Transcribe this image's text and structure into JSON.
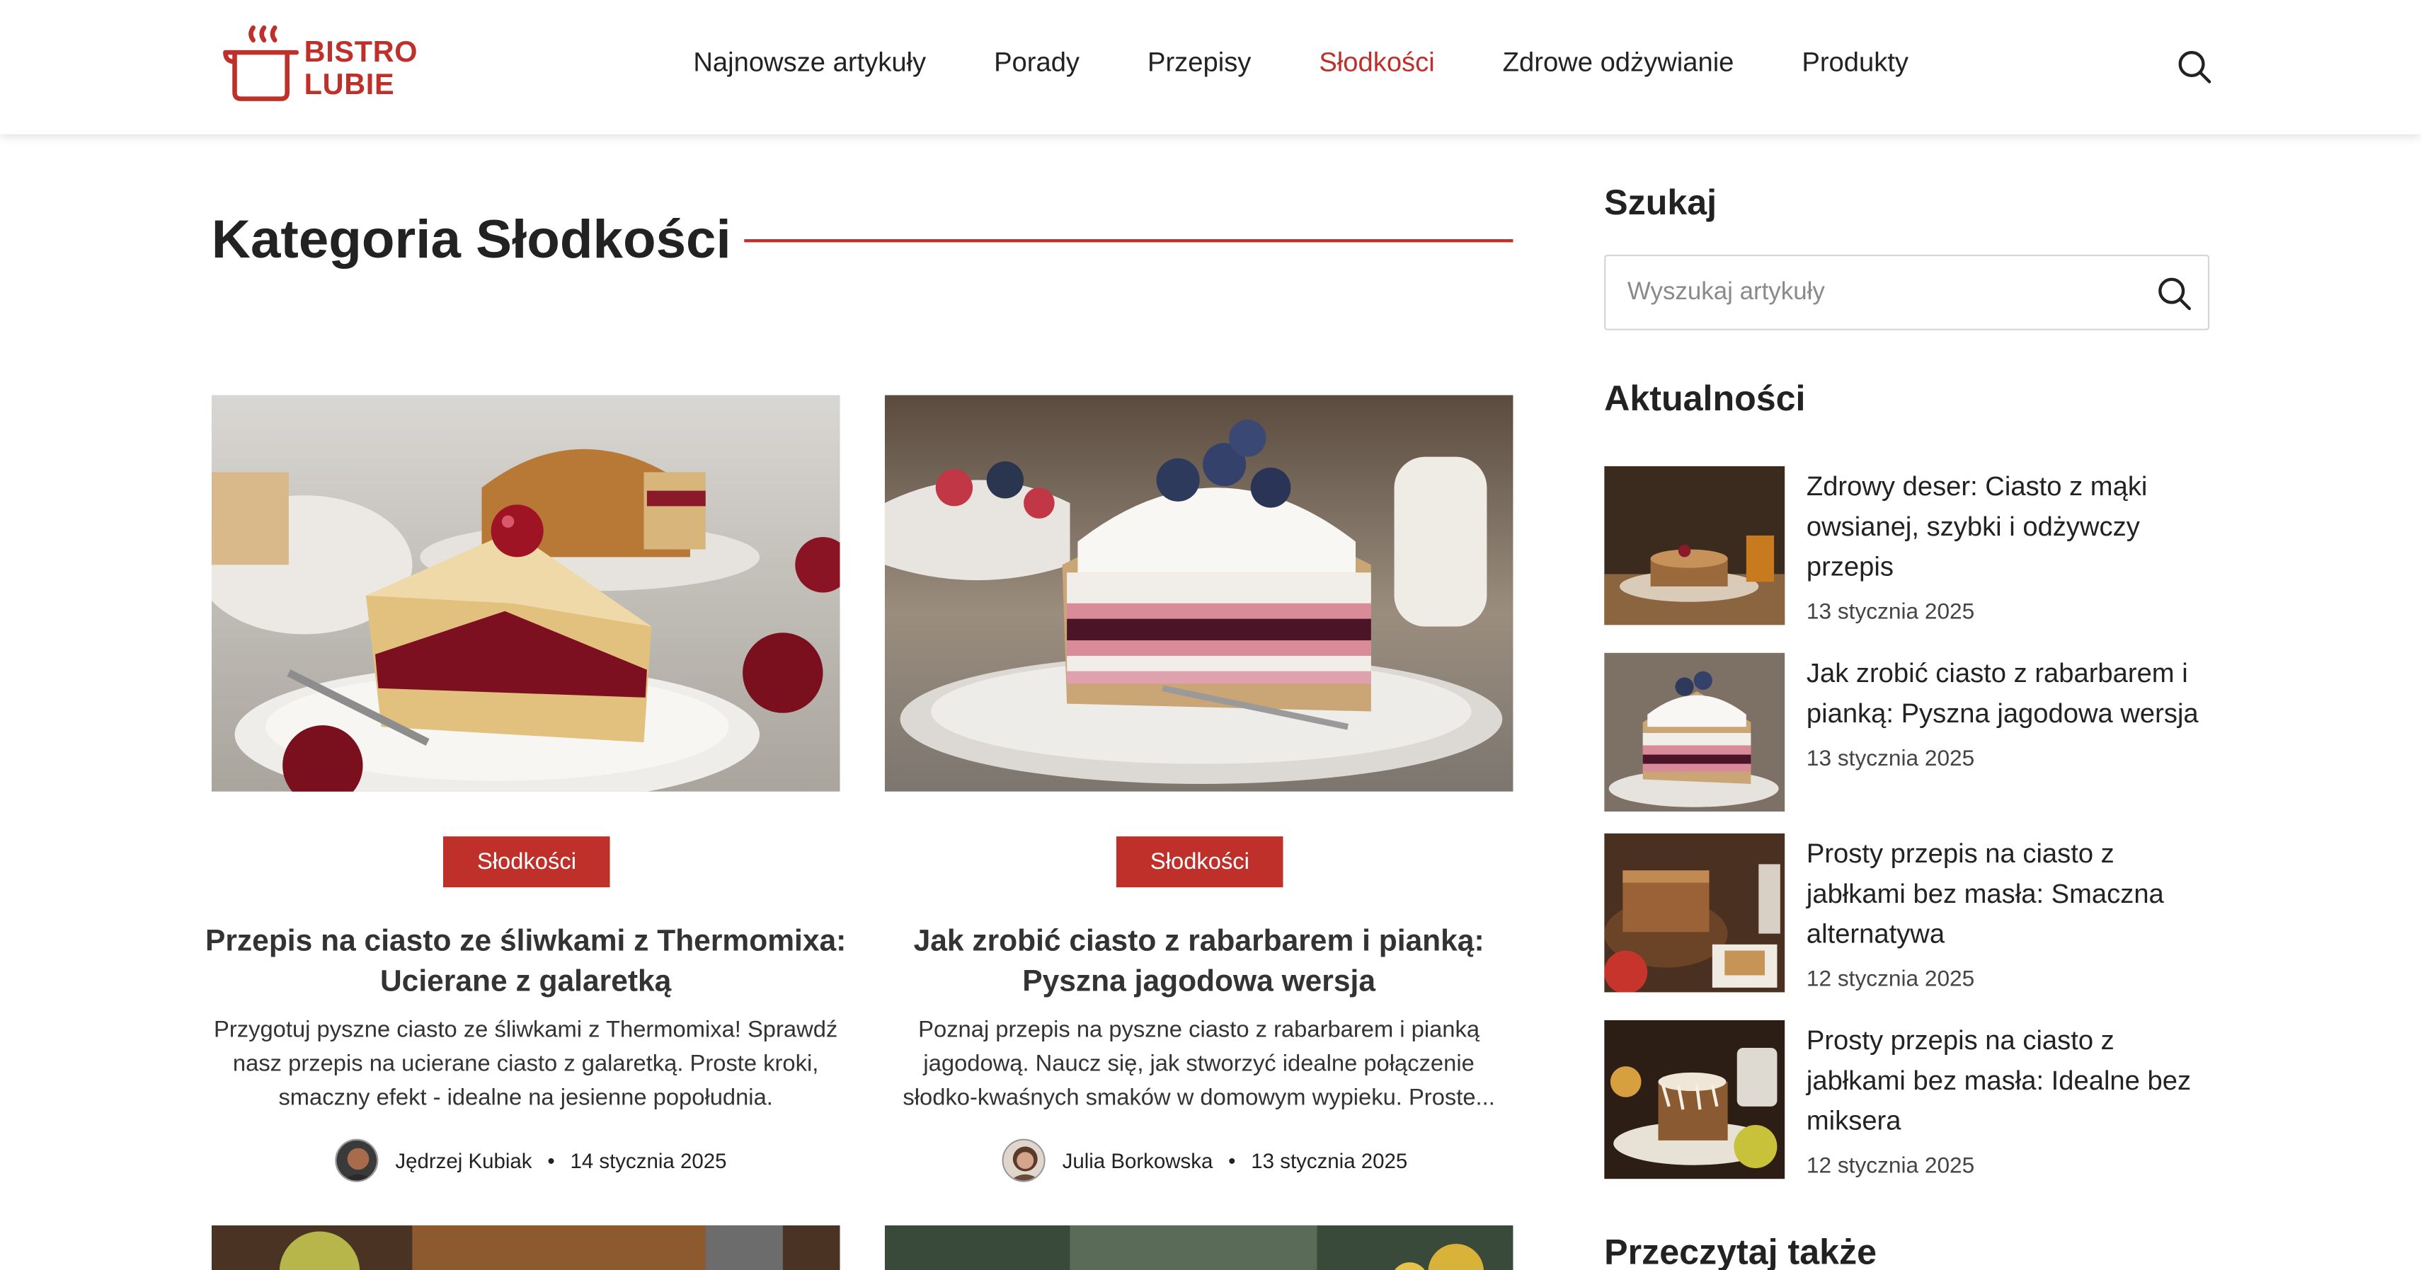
{
  "brand": {
    "line1": "BISTRO",
    "line2": "LUBIE",
    "color": "#c0302a"
  },
  "nav": {
    "items": [
      {
        "label": "Najnowsze artykuły",
        "active": false
      },
      {
        "label": "Porady",
        "active": false
      },
      {
        "label": "Przepisy",
        "active": false
      },
      {
        "label": "Słodkości",
        "active": true
      },
      {
        "label": "Zdrowe odżywianie",
        "active": false
      },
      {
        "label": "Produkty",
        "active": false
      }
    ],
    "search_icon": "search-icon"
  },
  "category": {
    "title": "Kategoria Słodkości"
  },
  "articles": [
    {
      "badge": "Słodkości",
      "title": "Przepis na ciasto ze śliwkami z Thermomixa: Ucierane z galaretką",
      "excerpt": "Przygotuj pyszne ciasto ze śliwkami z Thermomixa! Sprawdź nasz przepis na ucierane ciasto z galaretką. Proste kroki, smaczny efekt - idealne na jesienne popołudnia.",
      "author": "Jędrzej Kubiak",
      "date": "14 stycznia 2025"
    },
    {
      "badge": "Słodkości",
      "title": "Jak zrobić ciasto z rabarbarem i pianką: Pyszna jagodowa wersja",
      "excerpt": "Poznaj przepis na pyszne ciasto z rabarbarem i pianką jagodową. Naucz się, jak stworzyć idealne połączenie słodko-kwaśnych smaków w domowym wypieku. Proste...",
      "author": "Julia Borkowska",
      "date": "13 stycznia 2025"
    }
  ],
  "sidebar": {
    "search_heading": "Szukaj",
    "search_placeholder": "Wyszukaj artykuły",
    "news_heading": "Aktualności",
    "news": [
      {
        "title": "Zdrowy deser: Ciasto z mąki owsianej, szybki i odżywczy przepis",
        "date": "13 stycznia 2025"
      },
      {
        "title": "Jak zrobić ciasto z rabarbarem i pianką: Pyszna jagodowa wersja",
        "date": "13 stycznia 2025"
      },
      {
        "title": "Prosty przepis na ciasto z jabłkami bez masła: Smaczna alternatywa",
        "date": "12 stycznia 2025"
      },
      {
        "title": "Prosty przepis na ciasto z jabłkami bez masła: Idealne bez miksera",
        "date": "12 stycznia 2025"
      }
    ],
    "also_heading": "Przeczytaj także"
  }
}
